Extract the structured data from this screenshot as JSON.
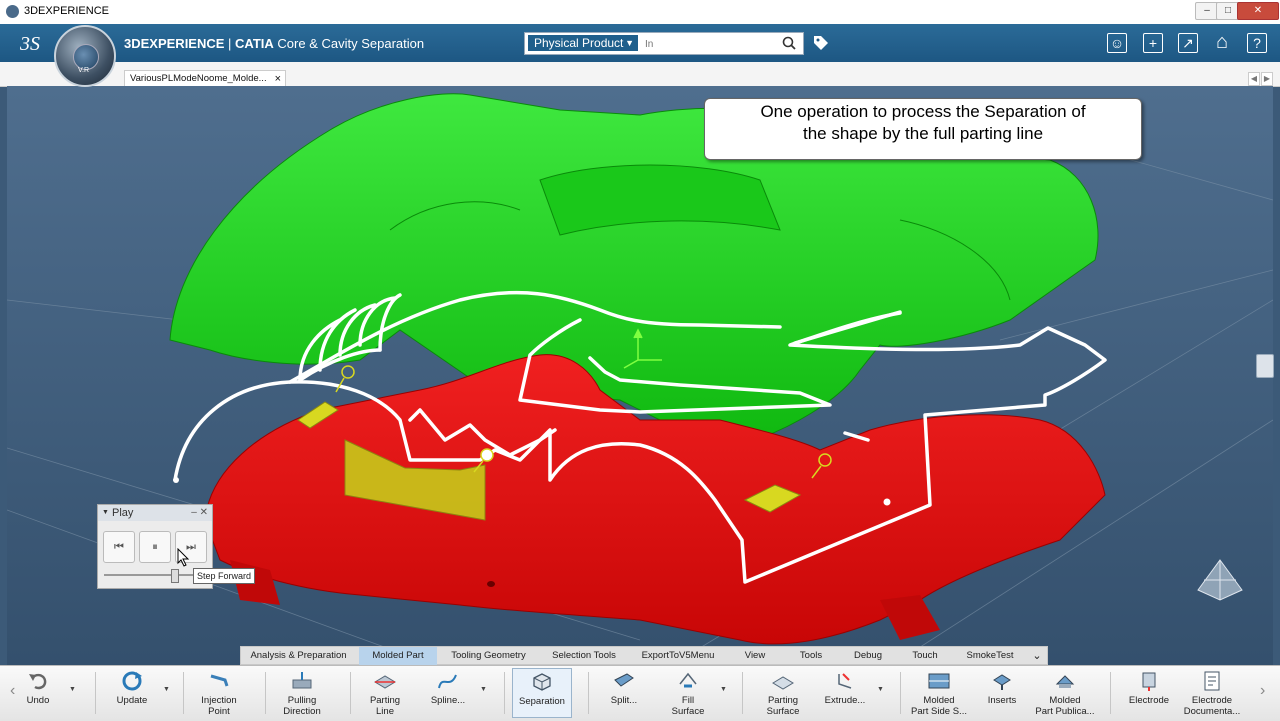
{
  "window": {
    "title": "3DEXPERIENCE",
    "controls": [
      "–",
      "□",
      "✕"
    ]
  },
  "appbar": {
    "brand": "3DEXPERIENCE",
    "separator": " | ",
    "app_bold": "CATIA",
    "app_rest": " Core & Cavity Separation",
    "compass_label": "V.R",
    "search_scope": "Physical Product",
    "search_placeholder": "In"
  },
  "tabs": {
    "doc_tab": "VariousPLModeNoome_Molde...",
    "close": "×"
  },
  "callout": {
    "line1": "One operation to process the Separation of",
    "line2": "the shape by the full parting line"
  },
  "play_panel": {
    "title": "Play",
    "tooltip": "Step Forward",
    "slider_fraction": 0.7
  },
  "section_tabs": [
    {
      "label": "Analysis & Preparation"
    },
    {
      "label": "Molded Part"
    },
    {
      "label": "Tooling Geometry"
    },
    {
      "label": "Selection Tools"
    },
    {
      "label": "ExportToV5Menu"
    },
    {
      "label": "View"
    },
    {
      "label": "Tools"
    },
    {
      "label": "Debug"
    },
    {
      "label": "Touch"
    },
    {
      "label": "SmokeTest"
    }
  ],
  "toolbar": {
    "undo": "Undo",
    "update": "Update",
    "injection": [
      "Injection",
      "Point"
    ],
    "pulling": [
      "Pulling",
      "Direction"
    ],
    "parting_line": [
      "Parting",
      "Line"
    ],
    "spline": "Spline...",
    "separation": "Separation",
    "split": "Split...",
    "fill": [
      "Fill",
      "Surface"
    ],
    "parting_surface": [
      "Parting",
      "Surface"
    ],
    "extrude": "Extrude...",
    "molded_side": [
      "Molded",
      "Part Side S..."
    ],
    "inserts": "Inserts",
    "molded_pub": [
      "Molded",
      "Part Publica..."
    ],
    "electrode": "Electrode",
    "electrode_doc": [
      "Electrode",
      "Documenta..."
    ]
  },
  "colors": {
    "upper_part": "#1fd11f",
    "lower_part": "#e40f0f",
    "background": "#3c5a78",
    "parting_line": "#ffffff",
    "inserts": "#d8d820"
  }
}
